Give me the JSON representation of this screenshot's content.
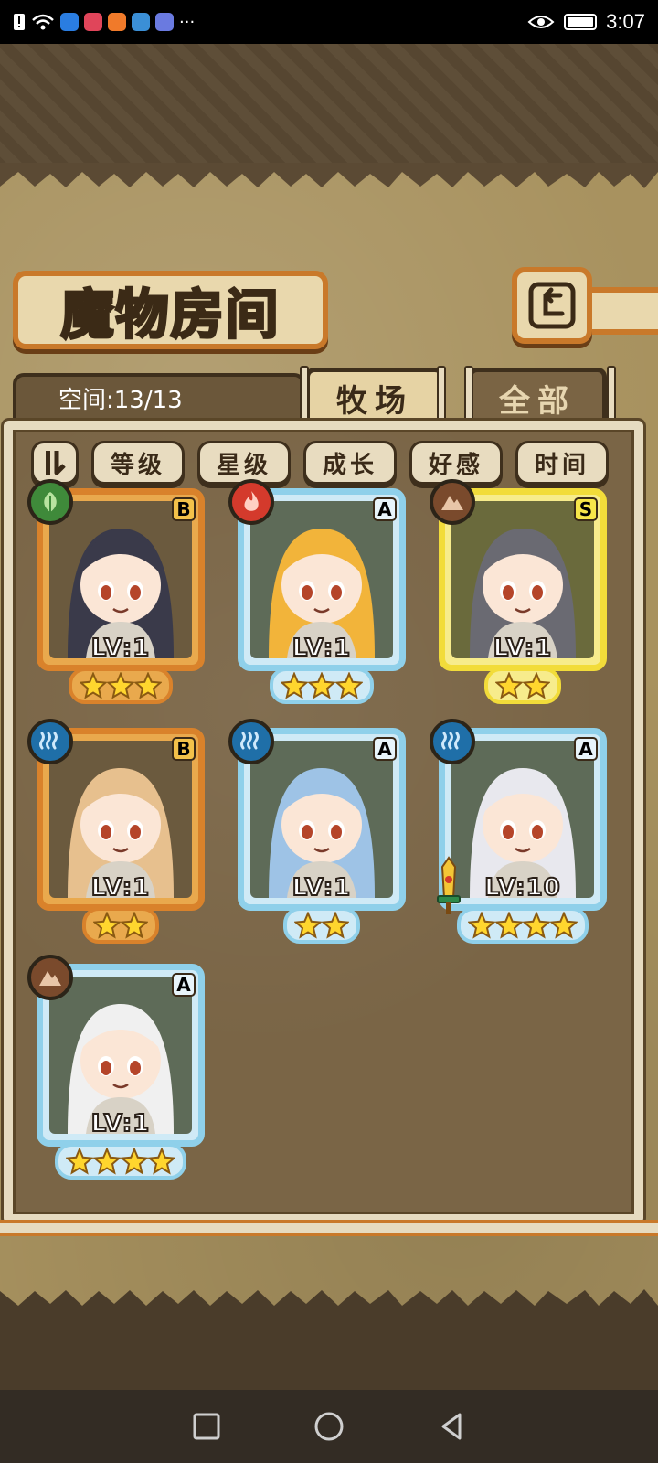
{
  "status_bar": {
    "time": "3:07",
    "icons": [
      "alert-icon",
      "wifi-icon",
      "app-icon-1",
      "app-icon-2",
      "app-icon-3",
      "app-icon-4",
      "app-icon-5",
      "more-icon",
      "eye-icon",
      "battery-icon"
    ],
    "more": "···"
  },
  "header": {
    "title": "魔物房间",
    "back_icon": "return-icon"
  },
  "tabs": {
    "space_label": "空间:13/13",
    "items": [
      {
        "label": "牧场",
        "active": true
      },
      {
        "label": "全部",
        "active": false
      }
    ]
  },
  "filters": {
    "sort_icon": "sort-order-icon",
    "items": [
      "等级",
      "星级",
      "成长",
      "好感",
      "时间"
    ]
  },
  "monsters": [
    {
      "level": "LV:1",
      "rank": "B",
      "element": "nature",
      "stars": 3,
      "frame": "orange"
    },
    {
      "level": "LV:1",
      "rank": "A",
      "element": "fire",
      "stars": 3,
      "frame": "blue"
    },
    {
      "level": "LV:1",
      "rank": "S",
      "element": "earth",
      "stars": 2,
      "frame": "gold"
    },
    {
      "level": "LV:1",
      "rank": "B",
      "element": "water",
      "stars": 2,
      "frame": "orange"
    },
    {
      "level": "LV:1",
      "rank": "A",
      "element": "water",
      "stars": 2,
      "frame": "blue"
    },
    {
      "level": "LV:10",
      "rank": "A",
      "element": "water",
      "stars": 4,
      "frame": "blue",
      "weapon": true
    },
    {
      "level": "LV:1",
      "rank": "A",
      "element": "earth",
      "stars": 4,
      "frame": "blue"
    }
  ],
  "colors": {
    "orange_frame": "#d9822b",
    "blue_frame": "#8fd0ea",
    "gold_frame": "#f2dc3a",
    "nature": "#3f8a3a",
    "fire": "#d43a2c",
    "earth": "#7a4a2c",
    "water": "#1f6fa8"
  },
  "navbar": {
    "icons": [
      "recent-apps-icon",
      "home-icon",
      "back-icon"
    ]
  }
}
